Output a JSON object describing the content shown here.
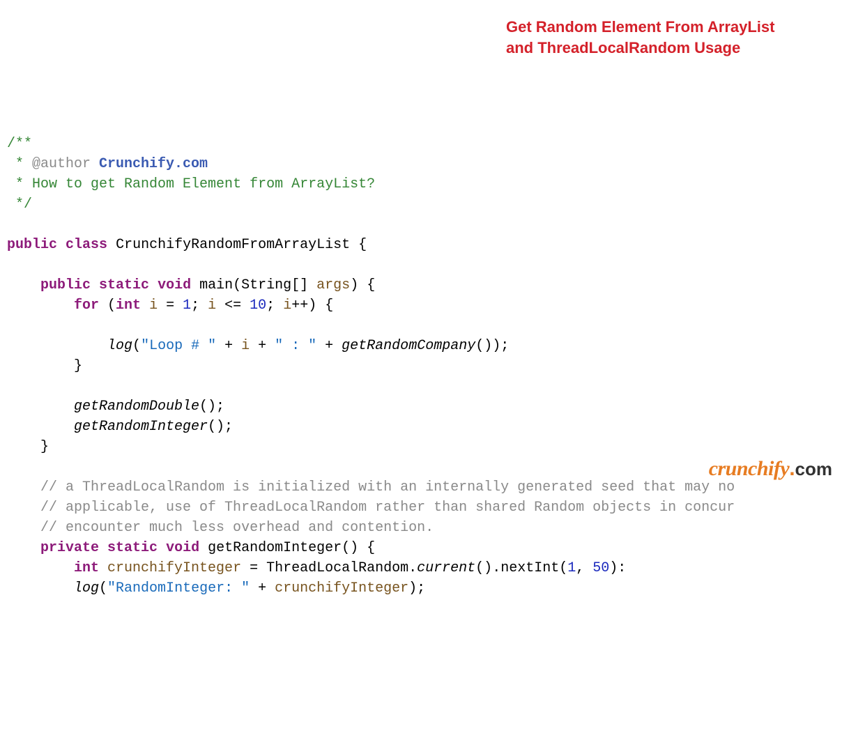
{
  "overlay": {
    "line1": "Get Random Element From ArrayList",
    "line2": "and ThreadLocalRandom Usage"
  },
  "code": {
    "docopen": "/**",
    "docstar1": " * ",
    "author_tag": "@author",
    "author_name": " Crunchify.com",
    "docstar2": " * ",
    "doc_desc": "How to get Random Element from ArrayList?",
    "docclose": " */",
    "kw_public": "public",
    "kw_class": "class",
    "class_name": "CrunchifyRandomFromArrayList",
    "brace_open": " {",
    "kw_static": "static",
    "kw_void": "void",
    "main_name": "main",
    "main_params_open": "(",
    "string_type": "String",
    "array_sfx": "[]",
    "args_name": " args",
    "main_params_close": ")",
    "kw_for": "for",
    "for_open": " (",
    "kw_int": "int",
    "var_i": " i",
    "assign": " = ",
    "num1": "1",
    "semi": "; ",
    "i_ref1": "i",
    "lte": " <= ",
    "num10": "10",
    "i_ref2": "i",
    "incr": "++",
    "for_close": ") {",
    "log_call": "log",
    "paren_open": "(",
    "str_loop": "\"Loop # \"",
    "plus": " + ",
    "i_ref3": "i",
    "str_colon": "\" : \"",
    "getRandomCompany": "getRandomCompany",
    "empty_call": "()",
    "paren_close_semi": ");",
    "brace_close": "}",
    "getRandomDouble": "getRandomDouble",
    "getRandomInteger": "getRandomInteger",
    "call_end": "();",
    "cmt1": "// a ThreadLocalRandom is initialized with an internally generated seed that may no",
    "cmt2": "// applicable, use of ThreadLocalRandom rather than shared Random objects in concur",
    "cmt3": "// encounter much less overhead and contention.",
    "kw_private": "private",
    "getRandomInteger_def": "getRandomInteger",
    "var_crunchifyInteger": " crunchifyInteger",
    "tlr_class": "ThreadLocalRandom",
    "dot": ".",
    "current": "current",
    "nextInt": "nextInt",
    "args_open": "(",
    "arg1": "1",
    "comma": ", ",
    "arg50": "50",
    "args_close": "):",
    "str_randint": "\"RandomInteger: \"",
    "var_ci_ref": "crunchifyInteger"
  },
  "logo": {
    "script": "crunchify",
    "dot": ".",
    "tld": "com"
  }
}
